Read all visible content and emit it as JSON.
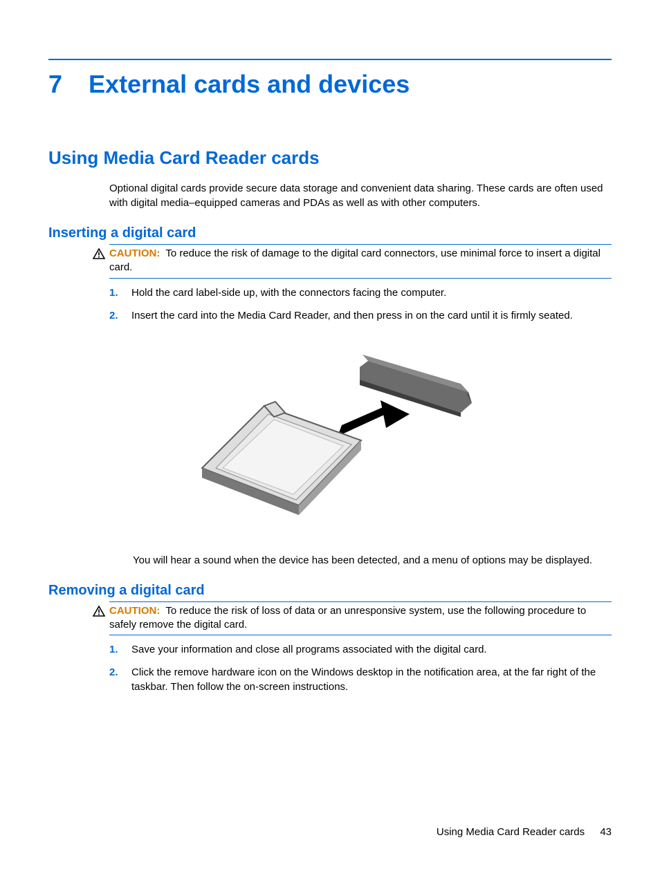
{
  "chapter": {
    "number": "7",
    "title": "External cards and devices"
  },
  "h2": "Using Media Card Reader cards",
  "intro": "Optional digital cards provide secure data storage and convenient data sharing. These cards are often used with digital media–equipped cameras and PDAs as well as with other computers.",
  "section1": {
    "title": "Inserting a digital card",
    "caution_label": "CAUTION:",
    "caution_text": "To reduce the risk of damage to the digital card connectors, use minimal force to insert a digital card.",
    "steps": [
      {
        "num": "1.",
        "text": "Hold the card label-side up, with the connectors facing the computer."
      },
      {
        "num": "2.",
        "text": "Insert the card into the Media Card Reader, and then press in on the card until it is firmly seated."
      }
    ],
    "after": "You will hear a sound when the device has been detected, and a menu of options may be displayed."
  },
  "section2": {
    "title": "Removing a digital card",
    "caution_label": "CAUTION:",
    "caution_text": "To reduce the risk of loss of data or an unresponsive system, use the following procedure to safely remove the digital card.",
    "steps": [
      {
        "num": "1.",
        "text": "Save your information and close all programs associated with the digital card."
      },
      {
        "num": "2.",
        "text": "Click the remove hardware icon on the Windows desktop in the notification area, at the far right of the taskbar. Then follow the on-screen instructions."
      }
    ]
  },
  "footer": {
    "section": "Using Media Card Reader cards",
    "page": "43"
  }
}
